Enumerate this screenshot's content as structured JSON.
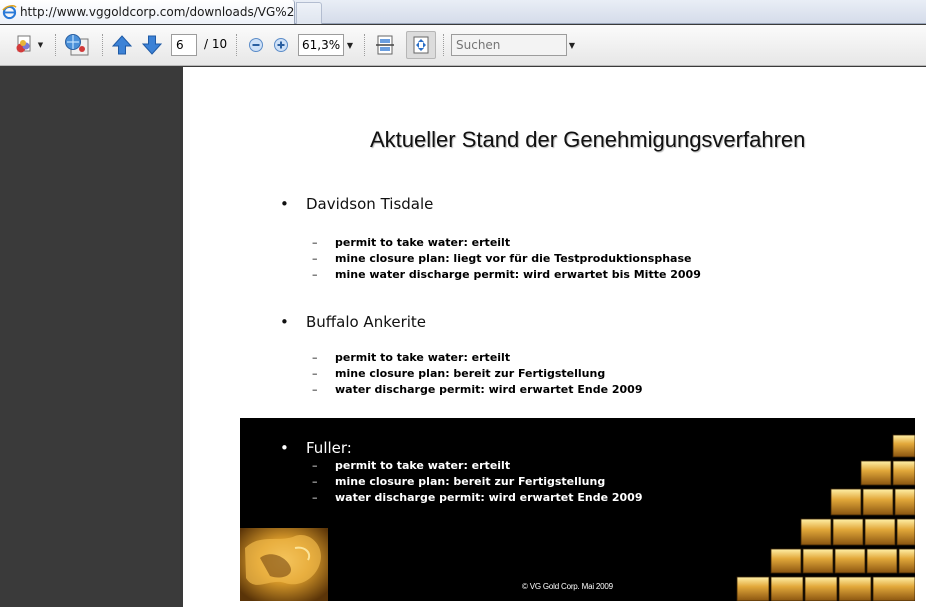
{
  "browser": {
    "tab_title": "http://www.vggoldcorp.com/downloads/VG%20..."
  },
  "toolbar": {
    "page_current": "6",
    "page_total": "/ 10",
    "zoom": "61,3%",
    "search_placeholder": "Suchen"
  },
  "slide": {
    "title": "Aktueller Stand der Genehmigungsverfahren",
    "sections": [
      {
        "bullet": "•",
        "name": "Davidson Tisdale",
        "items": [
          "permit to take water: erteilt",
          "mine closure plan: liegt vor für die Testproduktionsphase",
          "mine water discharge permit: wird erwartet bis Mitte 2009"
        ]
      },
      {
        "bullet": "•",
        "name": "Buffalo Ankerite",
        "items": [
          "permit to take water: erteilt",
          "mine closure plan: bereit zur Fertigstellung",
          "water discharge permit: wird erwartet Ende 2009"
        ]
      },
      {
        "bullet": "•",
        "name": "Fuller:",
        "items": [
          "permit to take water: erteilt",
          "mine closure plan: bereit zur Fertigstellung",
          "water discharge permit: wird erwartet Ende 2009"
        ]
      }
    ],
    "dash": "–",
    "footer": "© VG Gold Corp. Mai 2009"
  },
  "colors": {
    "page_background": "#ffffff",
    "viewer_background": "#3a3a3a",
    "band_background": "#000000",
    "gold": "#d9a027"
  },
  "icons": [
    "ie-page-icon",
    "create-pdf-icon",
    "collaborate-icon",
    "previous-page-icon",
    "next-page-icon",
    "zoom-out-icon",
    "zoom-in-icon",
    "scrolling-mode-icon",
    "fit-page-icon",
    "dropdown-arrow-icon"
  ]
}
